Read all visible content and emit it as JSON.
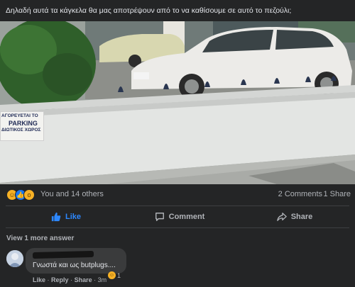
{
  "post": {
    "text": "Δηλαδή αυτά τα κάγκελα θα μας αποτρέψουν από το να καθίσουμε σε αυτό το πεζούλι;"
  },
  "photo": {
    "sign_line1": "ΑΓΟΡΕΥΕΤΑΙ ΤΟ",
    "sign_line2": "PARKING",
    "sign_line3": "ΔΙΩΤΙΚΟΣ ΧΩΡΟΣ"
  },
  "reactions": {
    "icons": [
      "haha-icon",
      "like-icon",
      "wow-icon"
    ],
    "summary": "You and 14 others",
    "comments": "2 Comments",
    "shares": "1 Share"
  },
  "actions": {
    "like": "Like",
    "comment": "Comment",
    "share": "Share"
  },
  "comments_section": {
    "more_answers": "View 1 more answer",
    "comment": {
      "text": "Γνωστά και ως butplugs....",
      "reaction_count": "1",
      "like": "Like",
      "reply": "Reply",
      "share": "Share",
      "time": "3m"
    }
  },
  "colors": {
    "background": "#242526",
    "accent": "#2d88ff",
    "bubble": "#3a3b3c",
    "muted_text": "#b0b3b8"
  }
}
